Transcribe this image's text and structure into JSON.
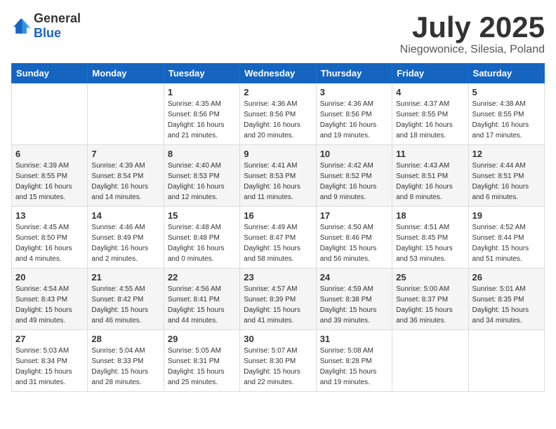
{
  "header": {
    "logo_general": "General",
    "logo_blue": "Blue",
    "month_title": "July 2025",
    "location": "Niegowonice, Silesia, Poland"
  },
  "days_of_week": [
    "Sunday",
    "Monday",
    "Tuesday",
    "Wednesday",
    "Thursday",
    "Friday",
    "Saturday"
  ],
  "weeks": [
    [
      {
        "day": "",
        "sunrise": "",
        "sunset": "",
        "daylight": ""
      },
      {
        "day": "",
        "sunrise": "",
        "sunset": "",
        "daylight": ""
      },
      {
        "day": "1",
        "sunrise": "Sunrise: 4:35 AM",
        "sunset": "Sunset: 8:56 PM",
        "daylight": "Daylight: 16 hours and 21 minutes."
      },
      {
        "day": "2",
        "sunrise": "Sunrise: 4:36 AM",
        "sunset": "Sunset: 8:56 PM",
        "daylight": "Daylight: 16 hours and 20 minutes."
      },
      {
        "day": "3",
        "sunrise": "Sunrise: 4:36 AM",
        "sunset": "Sunset: 8:56 PM",
        "daylight": "Daylight: 16 hours and 19 minutes."
      },
      {
        "day": "4",
        "sunrise": "Sunrise: 4:37 AM",
        "sunset": "Sunset: 8:55 PM",
        "daylight": "Daylight: 16 hours and 18 minutes."
      },
      {
        "day": "5",
        "sunrise": "Sunrise: 4:38 AM",
        "sunset": "Sunset: 8:55 PM",
        "daylight": "Daylight: 16 hours and 17 minutes."
      }
    ],
    [
      {
        "day": "6",
        "sunrise": "Sunrise: 4:39 AM",
        "sunset": "Sunset: 8:55 PM",
        "daylight": "Daylight: 16 hours and 15 minutes."
      },
      {
        "day": "7",
        "sunrise": "Sunrise: 4:39 AM",
        "sunset": "Sunset: 8:54 PM",
        "daylight": "Daylight: 16 hours and 14 minutes."
      },
      {
        "day": "8",
        "sunrise": "Sunrise: 4:40 AM",
        "sunset": "Sunset: 8:53 PM",
        "daylight": "Daylight: 16 hours and 12 minutes."
      },
      {
        "day": "9",
        "sunrise": "Sunrise: 4:41 AM",
        "sunset": "Sunset: 8:53 PM",
        "daylight": "Daylight: 16 hours and 11 minutes."
      },
      {
        "day": "10",
        "sunrise": "Sunrise: 4:42 AM",
        "sunset": "Sunset: 8:52 PM",
        "daylight": "Daylight: 16 hours and 9 minutes."
      },
      {
        "day": "11",
        "sunrise": "Sunrise: 4:43 AM",
        "sunset": "Sunset: 8:51 PM",
        "daylight": "Daylight: 16 hours and 8 minutes."
      },
      {
        "day": "12",
        "sunrise": "Sunrise: 4:44 AM",
        "sunset": "Sunset: 8:51 PM",
        "daylight": "Daylight: 16 hours and 6 minutes."
      }
    ],
    [
      {
        "day": "13",
        "sunrise": "Sunrise: 4:45 AM",
        "sunset": "Sunset: 8:50 PM",
        "daylight": "Daylight: 16 hours and 4 minutes."
      },
      {
        "day": "14",
        "sunrise": "Sunrise: 4:46 AM",
        "sunset": "Sunset: 8:49 PM",
        "daylight": "Daylight: 16 hours and 2 minutes."
      },
      {
        "day": "15",
        "sunrise": "Sunrise: 4:48 AM",
        "sunset": "Sunset: 8:48 PM",
        "daylight": "Daylight: 16 hours and 0 minutes."
      },
      {
        "day": "16",
        "sunrise": "Sunrise: 4:49 AM",
        "sunset": "Sunset: 8:47 PM",
        "daylight": "Daylight: 15 hours and 58 minutes."
      },
      {
        "day": "17",
        "sunrise": "Sunrise: 4:50 AM",
        "sunset": "Sunset: 8:46 PM",
        "daylight": "Daylight: 15 hours and 56 minutes."
      },
      {
        "day": "18",
        "sunrise": "Sunrise: 4:51 AM",
        "sunset": "Sunset: 8:45 PM",
        "daylight": "Daylight: 15 hours and 53 minutes."
      },
      {
        "day": "19",
        "sunrise": "Sunrise: 4:52 AM",
        "sunset": "Sunset: 8:44 PM",
        "daylight": "Daylight: 15 hours and 51 minutes."
      }
    ],
    [
      {
        "day": "20",
        "sunrise": "Sunrise: 4:54 AM",
        "sunset": "Sunset: 8:43 PM",
        "daylight": "Daylight: 15 hours and 49 minutes."
      },
      {
        "day": "21",
        "sunrise": "Sunrise: 4:55 AM",
        "sunset": "Sunset: 8:42 PM",
        "daylight": "Daylight: 15 hours and 46 minutes."
      },
      {
        "day": "22",
        "sunrise": "Sunrise: 4:56 AM",
        "sunset": "Sunset: 8:41 PM",
        "daylight": "Daylight: 15 hours and 44 minutes."
      },
      {
        "day": "23",
        "sunrise": "Sunrise: 4:57 AM",
        "sunset": "Sunset: 8:39 PM",
        "daylight": "Daylight: 15 hours and 41 minutes."
      },
      {
        "day": "24",
        "sunrise": "Sunrise: 4:59 AM",
        "sunset": "Sunset: 8:38 PM",
        "daylight": "Daylight: 15 hours and 39 minutes."
      },
      {
        "day": "25",
        "sunrise": "Sunrise: 5:00 AM",
        "sunset": "Sunset: 8:37 PM",
        "daylight": "Daylight: 15 hours and 36 minutes."
      },
      {
        "day": "26",
        "sunrise": "Sunrise: 5:01 AM",
        "sunset": "Sunset: 8:35 PM",
        "daylight": "Daylight: 15 hours and 34 minutes."
      }
    ],
    [
      {
        "day": "27",
        "sunrise": "Sunrise: 5:03 AM",
        "sunset": "Sunset: 8:34 PM",
        "daylight": "Daylight: 15 hours and 31 minutes."
      },
      {
        "day": "28",
        "sunrise": "Sunrise: 5:04 AM",
        "sunset": "Sunset: 8:33 PM",
        "daylight": "Daylight: 15 hours and 28 minutes."
      },
      {
        "day": "29",
        "sunrise": "Sunrise: 5:05 AM",
        "sunset": "Sunset: 8:31 PM",
        "daylight": "Daylight: 15 hours and 25 minutes."
      },
      {
        "day": "30",
        "sunrise": "Sunrise: 5:07 AM",
        "sunset": "Sunset: 8:30 PM",
        "daylight": "Daylight: 15 hours and 22 minutes."
      },
      {
        "day": "31",
        "sunrise": "Sunrise: 5:08 AM",
        "sunset": "Sunset: 8:28 PM",
        "daylight": "Daylight: 15 hours and 19 minutes."
      },
      {
        "day": "",
        "sunrise": "",
        "sunset": "",
        "daylight": ""
      },
      {
        "day": "",
        "sunrise": "",
        "sunset": "",
        "daylight": ""
      }
    ]
  ]
}
